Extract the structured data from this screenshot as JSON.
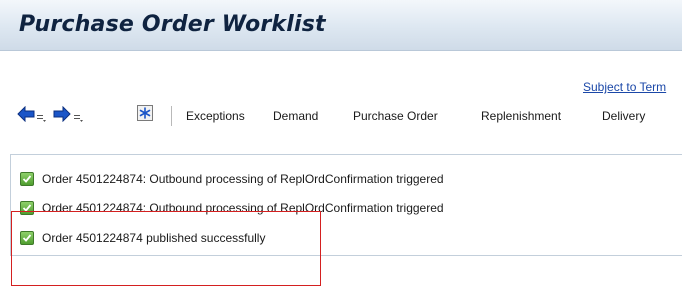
{
  "window": {
    "title": "Purchase Order Worklist"
  },
  "header": {
    "link_label": "Subject to Term"
  },
  "toolbar": {
    "back_icon": "arrow-left-icon",
    "forward_icon": "arrow-right-icon",
    "dropdown_icon": "small-menu-icon",
    "star_icon": "asterisk-icon",
    "items": [
      "Exceptions",
      "Demand",
      "Purchase Order",
      "Replenishment",
      "Delivery"
    ]
  },
  "messages": [
    {
      "status_icon": "checkmark-icon",
      "text": "Order 4501224874: Outbound processing of ReplOrdConfirmation triggered"
    },
    {
      "status_icon": "checkmark-icon",
      "text": "Order 4501224874: Outbound processing of ReplOrdConfirmation triggered"
    },
    {
      "status_icon": "checkmark-icon",
      "text": "Order 4501224874 published successfully"
    }
  ],
  "colors": {
    "title_text": "#0f2340",
    "link": "#1b48a8",
    "arrow_blue": "#1a55c8",
    "success_green": "#4f9e2f",
    "annotation_red": "#d42020"
  }
}
